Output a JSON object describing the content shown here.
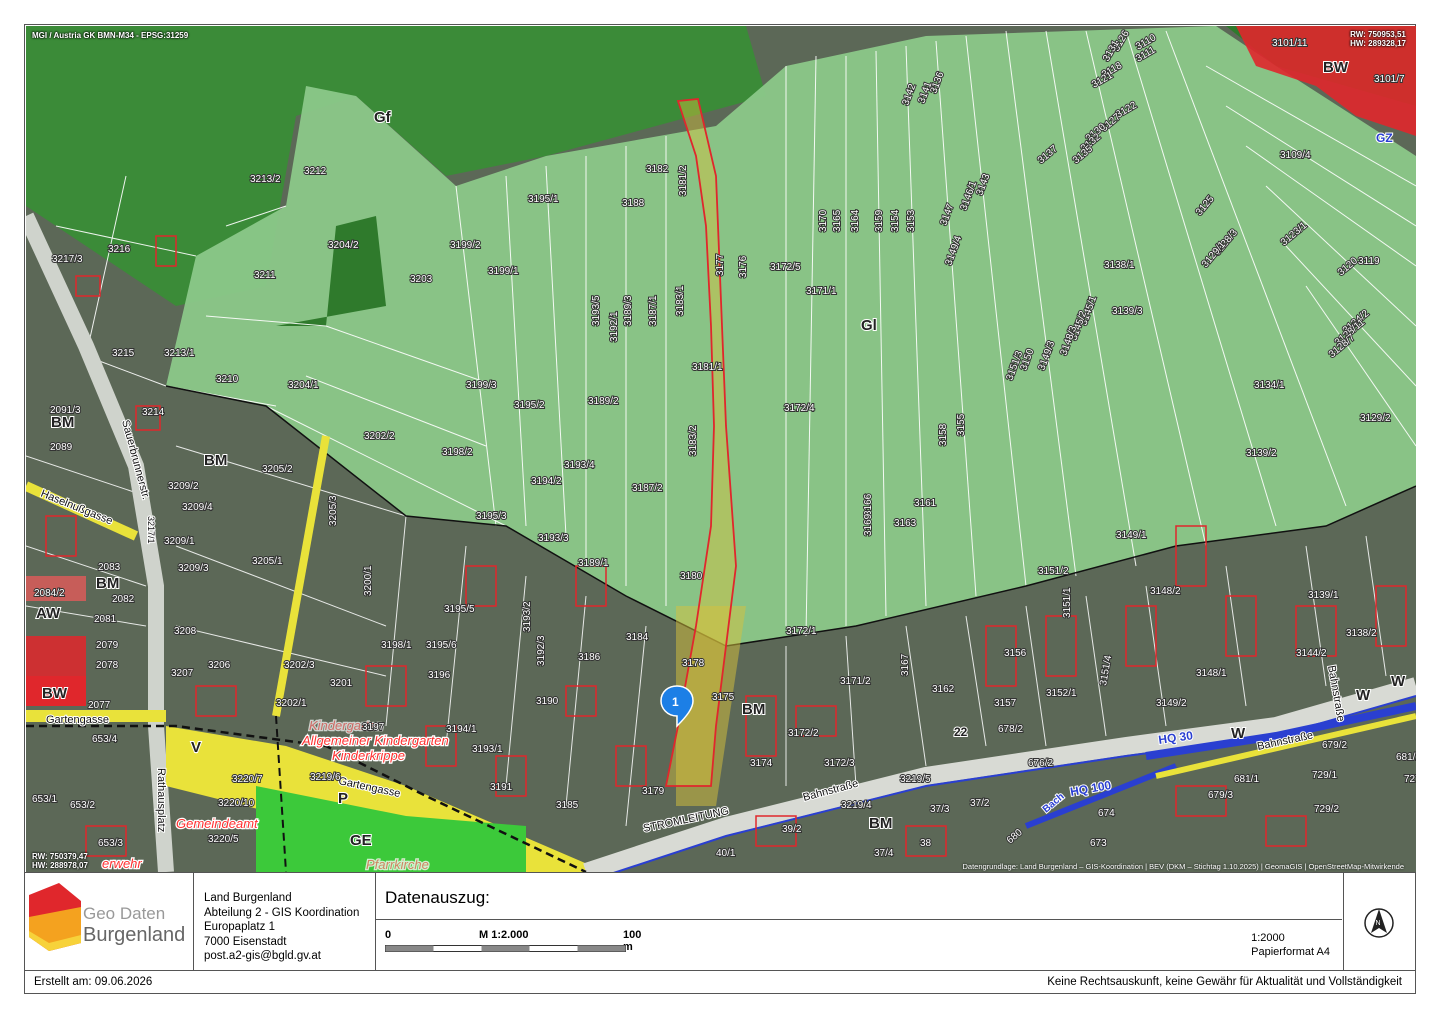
{
  "map": {
    "crs_label": "MGI / Austria GK BMN-M34 - EPSG:31259",
    "top_right_coords": [
      "RW: 750953,51",
      "HW: 289328,17"
    ],
    "bottom_left_coords": [
      "RW: 750379,47",
      "HW: 288978,07"
    ],
    "attribution": "Datengrundlage: Land Burgenland – GIS-Koordination | BEV (DKM – Stichtag 1.10.2025) | GeomaGIS | OpenStreetMap-Mitwirkende",
    "marker_number": "1",
    "zones": [
      {
        "label": "Gf"
      },
      {
        "label": "Gl"
      },
      {
        "label": "BM"
      },
      {
        "label": "BM"
      },
      {
        "label": "BM"
      },
      {
        "label": "BM"
      },
      {
        "label": "BM"
      },
      {
        "label": "BW"
      },
      {
        "label": "BW"
      },
      {
        "label": "AW"
      },
      {
        "label": "GE"
      },
      {
        "label": "GZ"
      },
      {
        "label": "V"
      },
      {
        "label": "P"
      },
      {
        "label": "W"
      },
      {
        "label": "W"
      },
      {
        "label": "W"
      }
    ],
    "parcels": [
      "3126",
      "3131",
      "3110",
      "3111",
      "3101/11",
      "3101/7",
      "3118",
      "3121",
      "3122",
      "3127",
      "3130",
      "3132",
      "3135",
      "3137",
      "3109/4",
      "3136",
      "3141",
      "3142",
      "3143",
      "3146/1",
      "3147",
      "3149/4",
      "3125",
      "3128/3",
      "3129/1",
      "3123/1",
      "3119",
      "3120",
      "3182",
      "3181/2",
      "3188",
      "3195/1",
      "3177",
      "3176",
      "3172/5",
      "3170",
      "3165",
      "3164",
      "3159",
      "3154",
      "3153",
      "3213/2",
      "3212",
      "3204/2",
      "3199/2",
      "3199/1",
      "3203",
      "3211",
      "3193/5",
      "3192/1",
      "3189/3",
      "3187/1",
      "3183/1",
      "3171/1",
      "3138/1",
      "3139/3",
      "3124/2",
      "3128/11",
      "3128/7",
      "3145/1",
      "3145/2",
      "3148/3",
      "3149/3",
      "3150",
      "3151/3",
      "3217/3",
      "3216",
      "3215",
      "3213/1",
      "3210",
      "3204/1",
      "3199/3",
      "3195/2",
      "3189/2",
      "3181/1",
      "3172/4",
      "3134/1",
      "3129/2",
      "2091/3",
      "3214",
      "2089",
      "3205/2",
      "3202/2",
      "3198/2",
      "3183/2",
      "3158",
      "3155",
      "3139/2",
      "3209/2",
      "3209/4",
      "3205/3",
      "3193/4",
      "3194/2",
      "3187/2",
      "3166",
      "3169",
      "3161",
      "3163",
      "3209/1",
      "3209/3",
      "3205/1",
      "3195/3",
      "3193/3",
      "3189/1",
      "3180",
      "3149/1",
      "2083",
      "2082",
      "2084/2",
      "3200/1",
      "3195/5",
      "3193/2",
      "3192/3",
      "3184",
      "3172/1",
      "3151/2",
      "3151/1",
      "3148/2",
      "3139/1",
      "2081",
      "2079",
      "2078",
      "3208",
      "3206",
      "3207",
      "3202/3",
      "3198/1",
      "3195/6",
      "3196",
      "3186",
      "3178",
      "3171/2",
      "3167",
      "3162",
      "3156",
      "3157",
      "3152/1",
      "3151/4",
      "3148/1",
      "3144/2",
      "3138/2",
      "3149/2",
      "2077",
      "3201",
      "3202/1",
      "3197",
      "3194/1",
      "3190",
      "3175",
      "3172/2",
      "3172/3",
      "3174",
      "678/2",
      "676/2",
      "653/4",
      "3193/1",
      "3191",
      "3185",
      "3179",
      "3219/6",
      "3219/5",
      "3219/4",
      "679/3",
      "681/1",
      "729/1",
      "727/2",
      "729/2",
      "653/1",
      "653/2",
      "3220/7",
      "3220/10",
      "3220/5",
      "653/3",
      "37/3",
      "37/2",
      "674",
      "673",
      "39/2",
      "40/1",
      "38",
      "37/4",
      "680",
      "681/2",
      "679/2"
    ],
    "streets": [
      "Sauerbrunnerstr.",
      "Haselnußgasse",
      "3217/1",
      "Gartengasse",
      "Gartengasse",
      "Rathausplatz",
      "Bahnstraße",
      "STROMLEITUNG",
      "Bahnstraße",
      "Bahnstraße"
    ],
    "places": [
      "Kindergarten",
      "Allgemeiner Kindergarten",
      "Kinderkrippe",
      "Gemeindeamt",
      "Pfarrkirche",
      "erwehr"
    ],
    "water_labels": [
      "HQ 30",
      "HQ 100",
      "Bach"
    ],
    "flood_labels": [
      "22"
    ],
    "colors": {
      "forest": "#3f8a3c",
      "green_light": "#8ec987",
      "built": "#5d6a58",
      "red_zone": "#e0272c",
      "selected_outline": "#e0272c",
      "selected_fill": "#d8c23c",
      "traffic": "#e9e23a",
      "water": "#2a3fd1",
      "ge_green": "#3cc93a"
    }
  },
  "footer": {
    "logo_text_top": "Geo Daten",
    "logo_text_bottom": "Burgenland",
    "address": [
      "Land Burgenland",
      "Abteilung 2 - GIS Koordination",
      "Europaplatz 1",
      "7000 Eisenstadt",
      "post.a2-gis@bgld.gv.at"
    ],
    "title": "Datenauszug:",
    "scale_start": "0",
    "scale_mid": "M 1:2.000",
    "scale_end": "100 m",
    "scale_ratio": "1:2000",
    "paper_format": "Papierformat A4",
    "created": "Erstellt am: 09.06.2026",
    "disclaimer": "Keine Rechtsauskunft, keine Gewähr für Aktualität und Vollständigkeit",
    "north_icon": "north-arrow-icon"
  }
}
